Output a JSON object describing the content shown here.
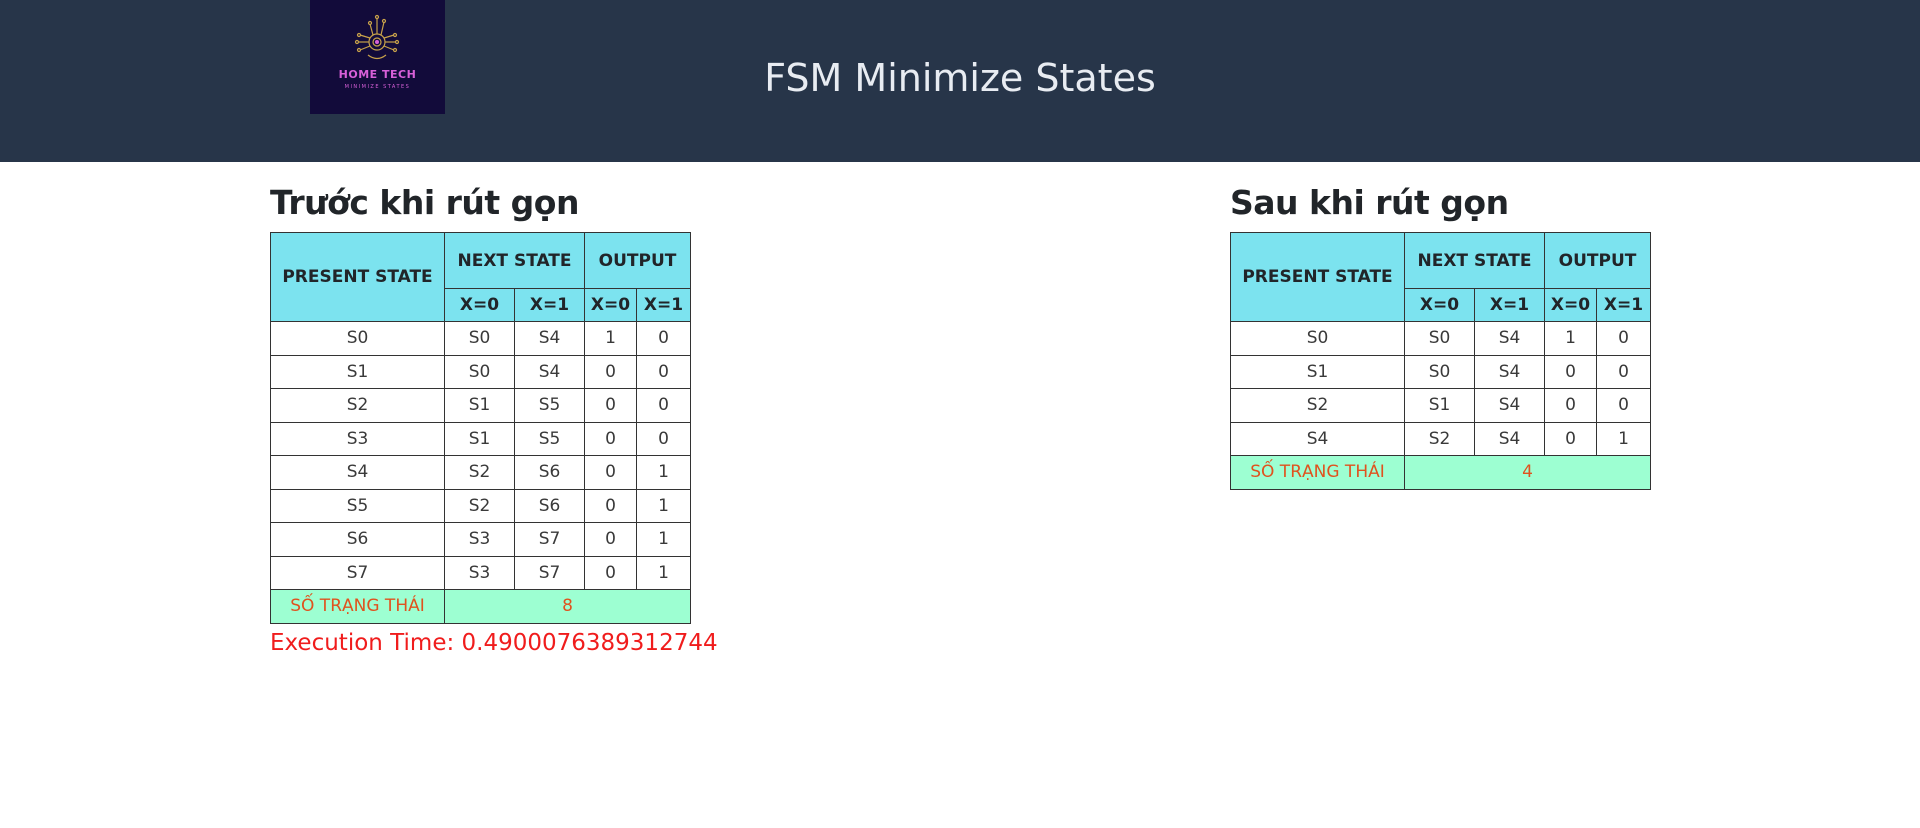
{
  "header": {
    "logo_brand": "HOME TECH",
    "logo_sub": "MINIMIZE STATES",
    "title": "FSM Minimize States"
  },
  "columns": {
    "present_state": "PRESENT STATE",
    "next_state": "NEXT STATE",
    "output": "OUTPUT",
    "x0": "X=0",
    "x1": "X=1"
  },
  "before": {
    "heading": "Trước khi rút gọn",
    "rows": [
      [
        "S0",
        "S0",
        "S4",
        "1",
        "0"
      ],
      [
        "S1",
        "S0",
        "S4",
        "0",
        "0"
      ],
      [
        "S2",
        "S1",
        "S5",
        "0",
        "0"
      ],
      [
        "S3",
        "S1",
        "S5",
        "0",
        "0"
      ],
      [
        "S4",
        "S2",
        "S6",
        "0",
        "1"
      ],
      [
        "S5",
        "S2",
        "S6",
        "0",
        "1"
      ],
      [
        "S6",
        "S3",
        "S7",
        "0",
        "1"
      ],
      [
        "S7",
        "S3",
        "S7",
        "0",
        "1"
      ]
    ],
    "count_label": "SỐ TRẠNG THÁI",
    "count_value": "8",
    "execution_time": "Execution Time: 0.4900076389312744"
  },
  "after": {
    "heading": "Sau khi rút gọn",
    "rows": [
      [
        "S0",
        "S0",
        "S4",
        "1",
        "0"
      ],
      [
        "S1",
        "S0",
        "S4",
        "0",
        "0"
      ],
      [
        "S2",
        "S1",
        "S4",
        "0",
        "0"
      ],
      [
        "S4",
        "S2",
        "S4",
        "0",
        "1"
      ]
    ],
    "count_label": "SỐ TRẠNG THÁI",
    "count_value": "4"
  }
}
